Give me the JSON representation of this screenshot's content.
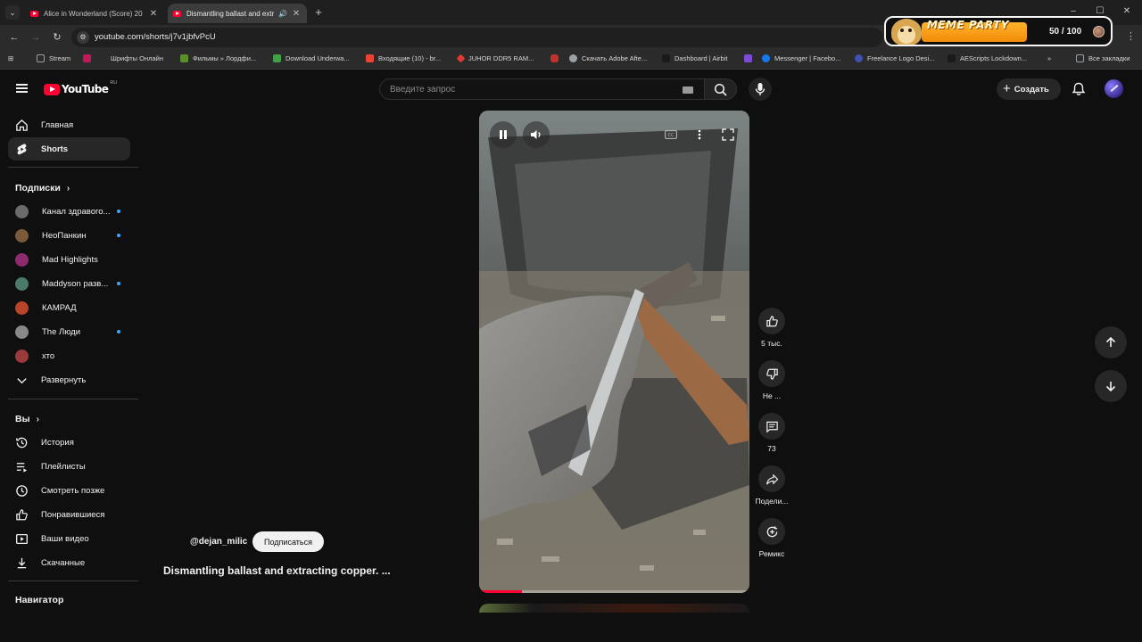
{
  "browser": {
    "tabs": [
      {
        "title": "Alice in Wonderland (Score) 20",
        "active": false
      },
      {
        "title": "Dismantling ballast and extr",
        "active": true
      }
    ],
    "url": "youtube.com/shorts/j7v1jbfvPcU",
    "bookmarks": [
      {
        "label": "Stream",
        "color": "#9aa0a6"
      },
      {
        "label": "Шрифты Онлайн",
        "color": "#c2185b"
      },
      {
        "label": "Фильмы » Лордфи...",
        "color": "#5a8f29"
      },
      {
        "label": "Download Underwa...",
        "color": "#43a047"
      },
      {
        "label": "Входящие (10) - br...",
        "color": "#ea4335"
      },
      {
        "label": "JUHOR DDR5 RAM...",
        "color": "#e53935"
      },
      {
        "label": "Скачать Adobe Afte...",
        "color": "#9aa0a6"
      },
      {
        "label": "Dashboard | Airbit",
        "color": "#222222"
      },
      {
        "label": "Messenger | Facebo...",
        "color": "#1877f2"
      },
      {
        "label": "Freelance Logo Desi...",
        "color": "#3f51b5"
      },
      {
        "label": "AEScripts Lockdown...",
        "color": "#222222"
      },
      {
        "label": "Все закладки",
        "color": "#9aa0a6"
      }
    ],
    "extension": {
      "title": "MEME PARTY",
      "score": "50 / 100"
    }
  },
  "youtube": {
    "logo": "YouTube",
    "region": "RU",
    "search_placeholder": "Введите запрос",
    "create_label": "Создать",
    "sidebar": {
      "home": "Главная",
      "shorts": "Shorts",
      "subscriptions_header": "Подписки",
      "channels": [
        {
          "name": "Канал здравого...",
          "color": "#6b6b6b",
          "new": true
        },
        {
          "name": "НеоПанкин",
          "color": "#7a5a3a",
          "new": true
        },
        {
          "name": "Mad Highlights",
          "color": "#8e2a6e",
          "new": false
        },
        {
          "name": "Maddyson разв...",
          "color": "#4a7a6a",
          "new": true
        },
        {
          "name": "КАМРАД",
          "color": "#b8442a",
          "new": false
        },
        {
          "name": "The Люди",
          "color": "#888888",
          "new": true
        },
        {
          "name": "хто",
          "color": "#9a3a3a",
          "new": false
        }
      ],
      "expand": "Развернуть",
      "you_header": "Вы",
      "you_items": [
        "История",
        "Плейлисты",
        "Смотреть позже",
        "Понравившиеся",
        "Ваши видео",
        "Скачанные"
      ],
      "navigator": "Навигатор"
    },
    "short": {
      "channel": "@dejan_milic",
      "subscribe": "Подписаться",
      "title": "Dismantling ballast and extracting copper. ...",
      "progress": 0.16
    },
    "actions": {
      "likes": "5 тыс.",
      "dislike": "Не ...",
      "comments": "73",
      "share": "Подели...",
      "remix": "Ремикс"
    }
  }
}
